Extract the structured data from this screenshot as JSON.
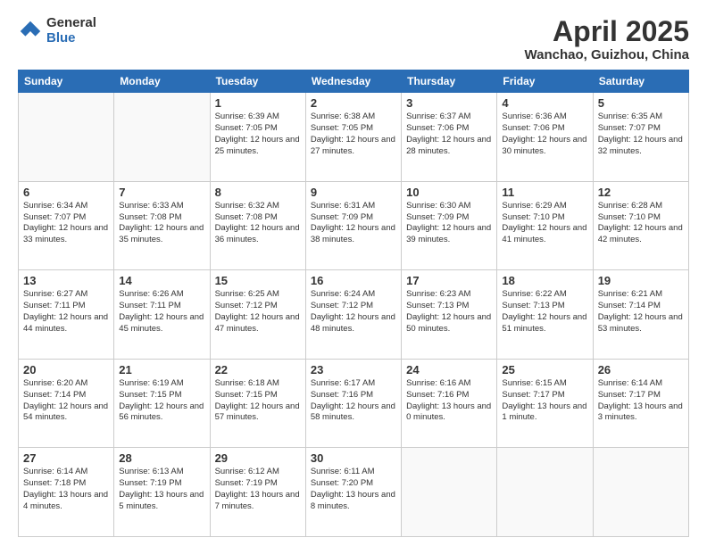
{
  "header": {
    "logo_general": "General",
    "logo_blue": "Blue",
    "title": "April 2025",
    "location": "Wanchao, Guizhou, China"
  },
  "days_of_week": [
    "Sunday",
    "Monday",
    "Tuesday",
    "Wednesday",
    "Thursday",
    "Friday",
    "Saturday"
  ],
  "weeks": [
    [
      {
        "day": null
      },
      {
        "day": null
      },
      {
        "day": "1",
        "sunrise": "Sunrise: 6:39 AM",
        "sunset": "Sunset: 7:05 PM",
        "daylight": "Daylight: 12 hours and 25 minutes."
      },
      {
        "day": "2",
        "sunrise": "Sunrise: 6:38 AM",
        "sunset": "Sunset: 7:05 PM",
        "daylight": "Daylight: 12 hours and 27 minutes."
      },
      {
        "day": "3",
        "sunrise": "Sunrise: 6:37 AM",
        "sunset": "Sunset: 7:06 PM",
        "daylight": "Daylight: 12 hours and 28 minutes."
      },
      {
        "day": "4",
        "sunrise": "Sunrise: 6:36 AM",
        "sunset": "Sunset: 7:06 PM",
        "daylight": "Daylight: 12 hours and 30 minutes."
      },
      {
        "day": "5",
        "sunrise": "Sunrise: 6:35 AM",
        "sunset": "Sunset: 7:07 PM",
        "daylight": "Daylight: 12 hours and 32 minutes."
      }
    ],
    [
      {
        "day": "6",
        "sunrise": "Sunrise: 6:34 AM",
        "sunset": "Sunset: 7:07 PM",
        "daylight": "Daylight: 12 hours and 33 minutes."
      },
      {
        "day": "7",
        "sunrise": "Sunrise: 6:33 AM",
        "sunset": "Sunset: 7:08 PM",
        "daylight": "Daylight: 12 hours and 35 minutes."
      },
      {
        "day": "8",
        "sunrise": "Sunrise: 6:32 AM",
        "sunset": "Sunset: 7:08 PM",
        "daylight": "Daylight: 12 hours and 36 minutes."
      },
      {
        "day": "9",
        "sunrise": "Sunrise: 6:31 AM",
        "sunset": "Sunset: 7:09 PM",
        "daylight": "Daylight: 12 hours and 38 minutes."
      },
      {
        "day": "10",
        "sunrise": "Sunrise: 6:30 AM",
        "sunset": "Sunset: 7:09 PM",
        "daylight": "Daylight: 12 hours and 39 minutes."
      },
      {
        "day": "11",
        "sunrise": "Sunrise: 6:29 AM",
        "sunset": "Sunset: 7:10 PM",
        "daylight": "Daylight: 12 hours and 41 minutes."
      },
      {
        "day": "12",
        "sunrise": "Sunrise: 6:28 AM",
        "sunset": "Sunset: 7:10 PM",
        "daylight": "Daylight: 12 hours and 42 minutes."
      }
    ],
    [
      {
        "day": "13",
        "sunrise": "Sunrise: 6:27 AM",
        "sunset": "Sunset: 7:11 PM",
        "daylight": "Daylight: 12 hours and 44 minutes."
      },
      {
        "day": "14",
        "sunrise": "Sunrise: 6:26 AM",
        "sunset": "Sunset: 7:11 PM",
        "daylight": "Daylight: 12 hours and 45 minutes."
      },
      {
        "day": "15",
        "sunrise": "Sunrise: 6:25 AM",
        "sunset": "Sunset: 7:12 PM",
        "daylight": "Daylight: 12 hours and 47 minutes."
      },
      {
        "day": "16",
        "sunrise": "Sunrise: 6:24 AM",
        "sunset": "Sunset: 7:12 PM",
        "daylight": "Daylight: 12 hours and 48 minutes."
      },
      {
        "day": "17",
        "sunrise": "Sunrise: 6:23 AM",
        "sunset": "Sunset: 7:13 PM",
        "daylight": "Daylight: 12 hours and 50 minutes."
      },
      {
        "day": "18",
        "sunrise": "Sunrise: 6:22 AM",
        "sunset": "Sunset: 7:13 PM",
        "daylight": "Daylight: 12 hours and 51 minutes."
      },
      {
        "day": "19",
        "sunrise": "Sunrise: 6:21 AM",
        "sunset": "Sunset: 7:14 PM",
        "daylight": "Daylight: 12 hours and 53 minutes."
      }
    ],
    [
      {
        "day": "20",
        "sunrise": "Sunrise: 6:20 AM",
        "sunset": "Sunset: 7:14 PM",
        "daylight": "Daylight: 12 hours and 54 minutes."
      },
      {
        "day": "21",
        "sunrise": "Sunrise: 6:19 AM",
        "sunset": "Sunset: 7:15 PM",
        "daylight": "Daylight: 12 hours and 56 minutes."
      },
      {
        "day": "22",
        "sunrise": "Sunrise: 6:18 AM",
        "sunset": "Sunset: 7:15 PM",
        "daylight": "Daylight: 12 hours and 57 minutes."
      },
      {
        "day": "23",
        "sunrise": "Sunrise: 6:17 AM",
        "sunset": "Sunset: 7:16 PM",
        "daylight": "Daylight: 12 hours and 58 minutes."
      },
      {
        "day": "24",
        "sunrise": "Sunrise: 6:16 AM",
        "sunset": "Sunset: 7:16 PM",
        "daylight": "Daylight: 13 hours and 0 minutes."
      },
      {
        "day": "25",
        "sunrise": "Sunrise: 6:15 AM",
        "sunset": "Sunset: 7:17 PM",
        "daylight": "Daylight: 13 hours and 1 minute."
      },
      {
        "day": "26",
        "sunrise": "Sunrise: 6:14 AM",
        "sunset": "Sunset: 7:17 PM",
        "daylight": "Daylight: 13 hours and 3 minutes."
      }
    ],
    [
      {
        "day": "27",
        "sunrise": "Sunrise: 6:14 AM",
        "sunset": "Sunset: 7:18 PM",
        "daylight": "Daylight: 13 hours and 4 minutes."
      },
      {
        "day": "28",
        "sunrise": "Sunrise: 6:13 AM",
        "sunset": "Sunset: 7:19 PM",
        "daylight": "Daylight: 13 hours and 5 minutes."
      },
      {
        "day": "29",
        "sunrise": "Sunrise: 6:12 AM",
        "sunset": "Sunset: 7:19 PM",
        "daylight": "Daylight: 13 hours and 7 minutes."
      },
      {
        "day": "30",
        "sunrise": "Sunrise: 6:11 AM",
        "sunset": "Sunset: 7:20 PM",
        "daylight": "Daylight: 13 hours and 8 minutes."
      },
      {
        "day": null
      },
      {
        "day": null
      },
      {
        "day": null
      }
    ]
  ]
}
